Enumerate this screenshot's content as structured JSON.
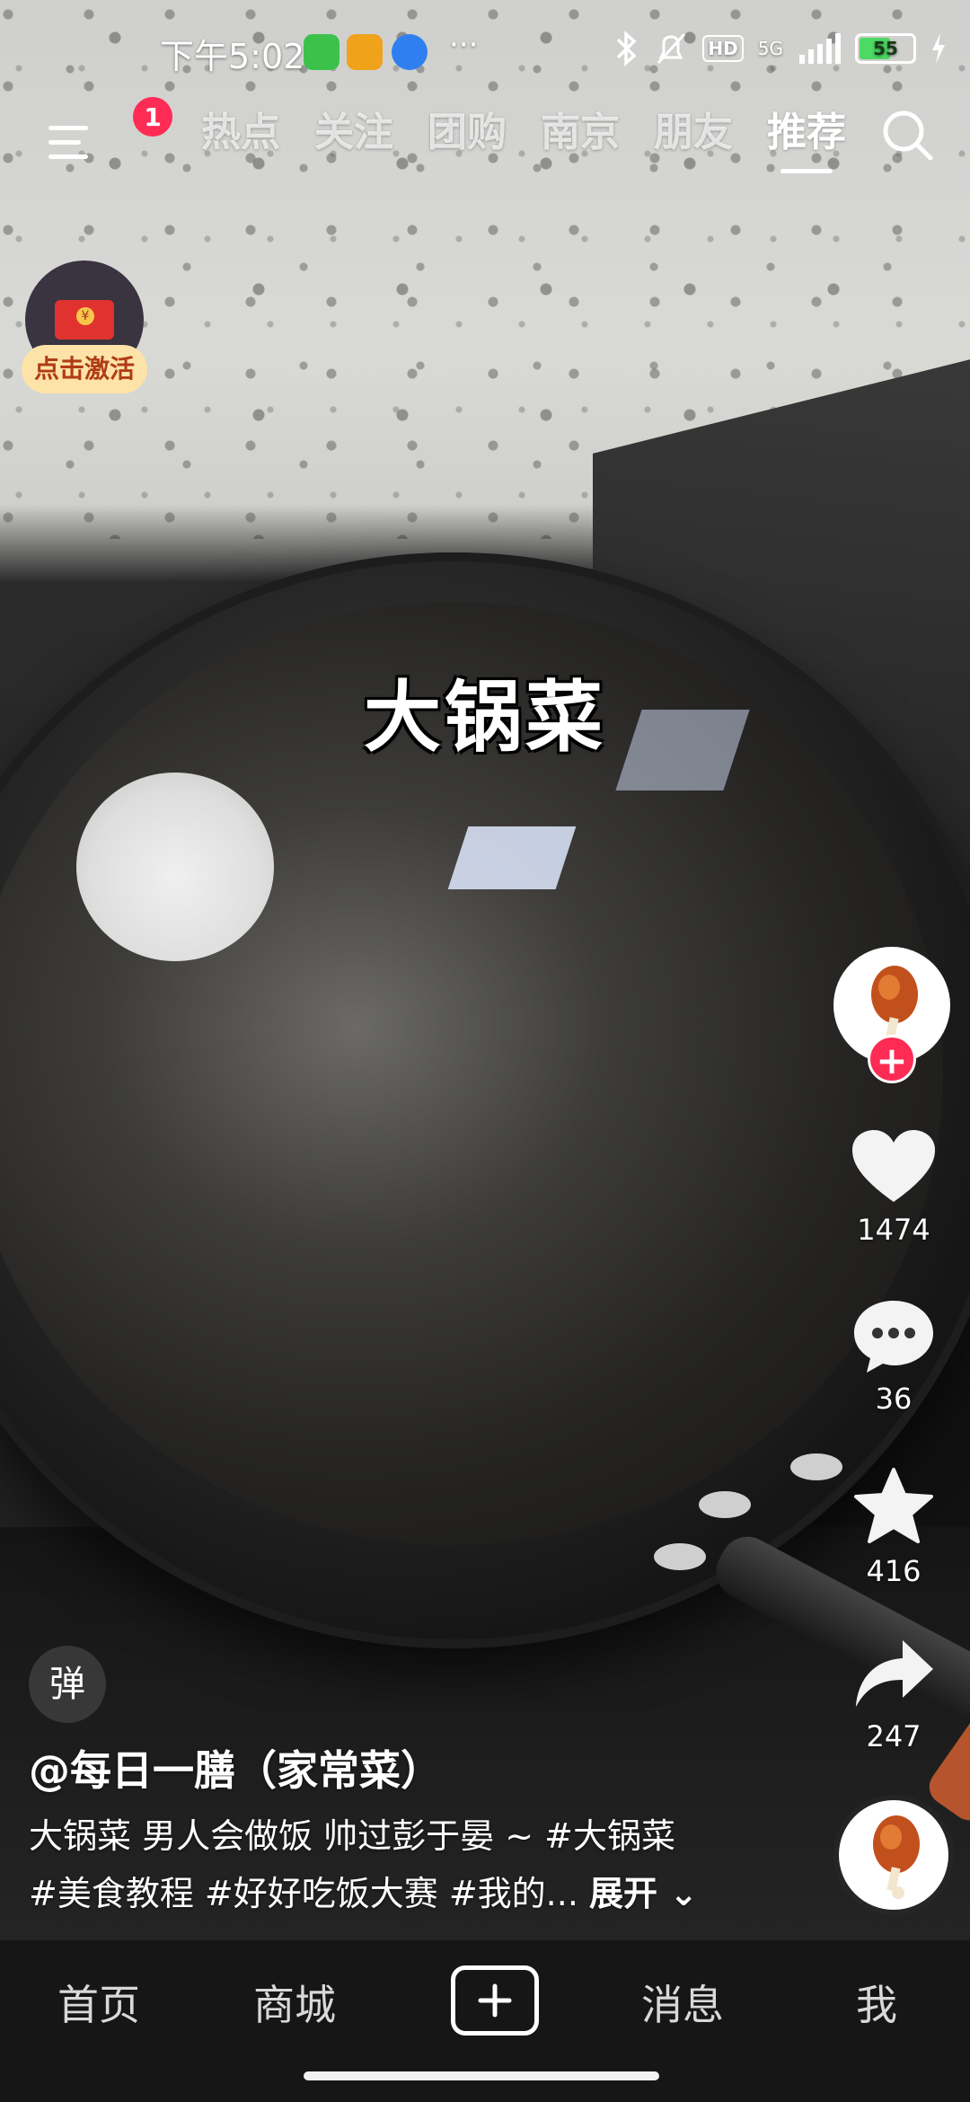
{
  "status_bar": {
    "time": "下午5:02",
    "network": "5G",
    "battery": "55"
  },
  "top_nav": {
    "notification_count": "1",
    "tabs": [
      {
        "label": "热点"
      },
      {
        "label": "关注"
      },
      {
        "label": "团购"
      },
      {
        "label": "南京"
      },
      {
        "label": "朋友"
      },
      {
        "label": "推荐",
        "active": true
      }
    ]
  },
  "activation": {
    "label": "点击激活"
  },
  "video": {
    "overlay_title": "大锅菜"
  },
  "actions": {
    "likes": "1474",
    "comments": "36",
    "favorites": "416",
    "shares": "247"
  },
  "caption": {
    "danmu": "弹",
    "author": "@每日一膳（家常菜）",
    "line1": "大锅菜 男人会做饭 帅过彭于晏 ~ #大锅菜",
    "line2": "#美食教程 #好好吃饭大赛 #我的...",
    "expand": "展开"
  },
  "bottom_nav": {
    "home": "首页",
    "mall": "商城",
    "messages": "消息",
    "me": "我"
  },
  "colors": {
    "accent": "#fe2c55",
    "tab_bar": "#161616"
  }
}
